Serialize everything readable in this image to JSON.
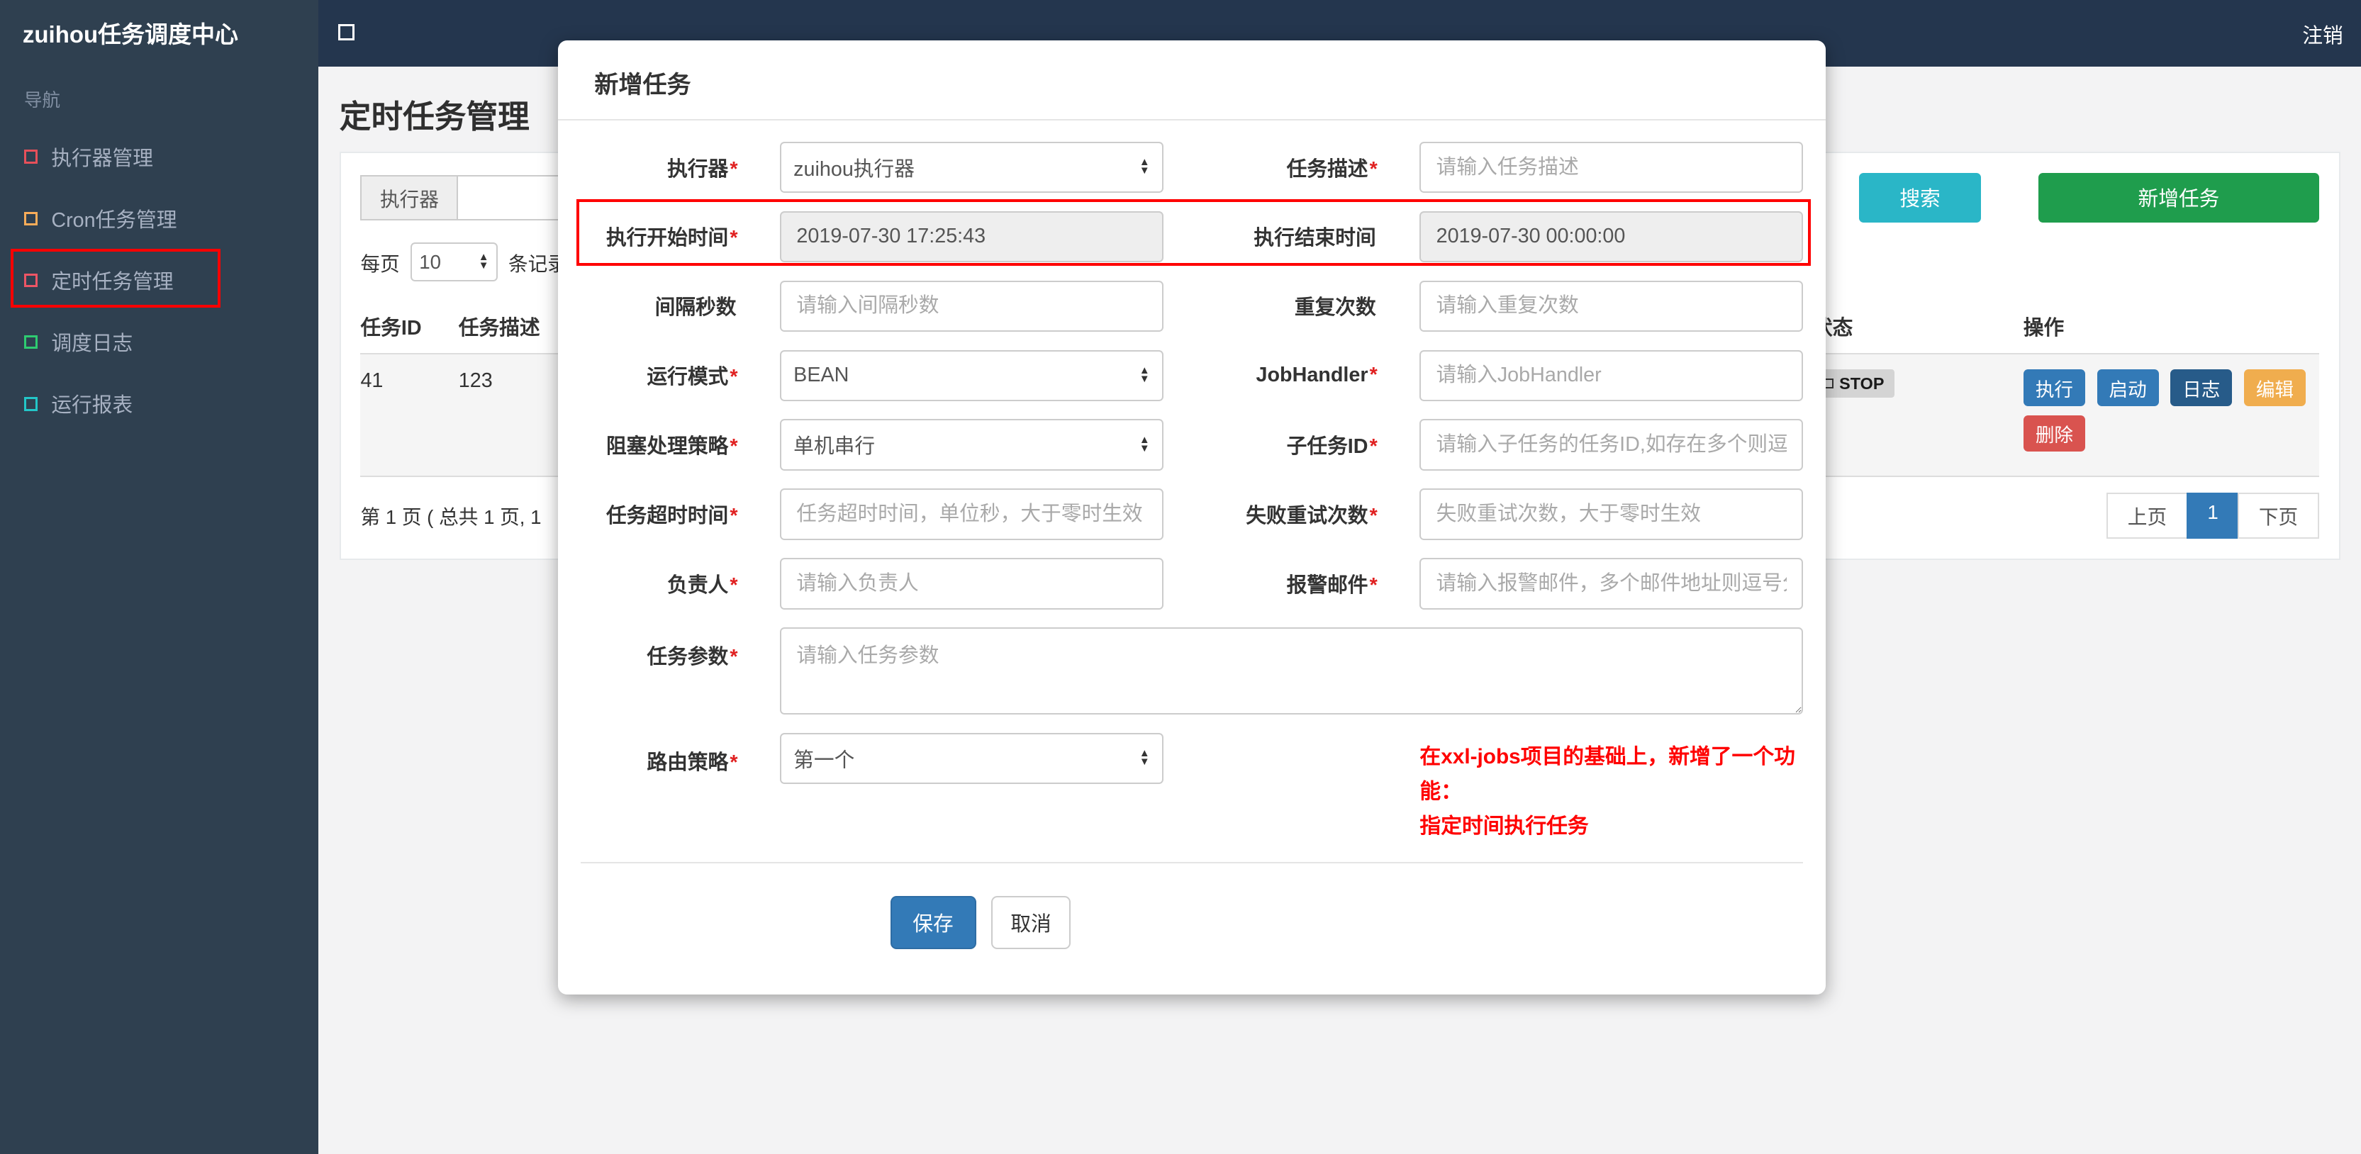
{
  "colors": {
    "annotation_red": "#ff0000",
    "search_button": "#2ab6c7",
    "add_button": "#1f9d4d",
    "save_button": "#337ab7",
    "status_stop_badge": "#d4d4d4",
    "note_red": "#ff0000"
  },
  "header": {
    "brand": "zuihou任务调度中心",
    "logout": "注销"
  },
  "sidebar": {
    "section_label": "导航",
    "items": [
      {
        "label": "执行器管理",
        "icon_color": "#e7505a"
      },
      {
        "label": "Cron任务管理",
        "icon_color": "#f8ac59"
      },
      {
        "label": "定时任务管理",
        "icon_color": "#ed5565"
      },
      {
        "label": "调度日志",
        "icon_color": "#2ecc71"
      },
      {
        "label": "运行报表",
        "icon_color": "#23c6c8"
      }
    ]
  },
  "page": {
    "title": "定时任务管理",
    "filter": {
      "executor_label": "执行器",
      "search": "搜索",
      "add_task": "新增任务"
    },
    "perpage": {
      "prefix": "每页",
      "value": "10",
      "suffix": "条记录"
    },
    "table": {
      "headers": {
        "id": "任务ID",
        "desc": "任务描述",
        "status": "状态",
        "actions": "操作"
      },
      "row": {
        "id": "41",
        "desc": "123",
        "status": "STOP",
        "btn_run": "执行",
        "btn_start": "启动",
        "btn_log": "日志",
        "btn_edit": "编辑",
        "btn_delete": "删除"
      }
    },
    "pagination": {
      "summary": "第 1 页 ( 总共 1 页, 1",
      "prev": "上页",
      "current": "1",
      "next": "下页"
    }
  },
  "modal": {
    "title": "新增任务",
    "rows": [
      {
        "l_label": "执行器",
        "l_req": "*",
        "l_value": "zuihou执行器",
        "r_label": "任务描述",
        "r_req": "*",
        "r_placeholder": "请输入任务描述"
      },
      {
        "l_label": "执行开始时间",
        "l_req": "*",
        "l_value": "2019-07-30 17:25:43",
        "r_label": "执行结束时间",
        "r_req": "",
        "r_value": "2019-07-30 00:00:00"
      },
      {
        "l_label": "间隔秒数",
        "l_req": "",
        "l_placeholder": "请输入间隔秒数",
        "r_label": "重复次数",
        "r_req": "",
        "r_placeholder": "请输入重复次数"
      },
      {
        "l_label": "运行模式",
        "l_req": "*",
        "l_value": "BEAN",
        "r_label": "JobHandler",
        "r_req": "*",
        "r_placeholder": "请输入JobHandler"
      },
      {
        "l_label": "阻塞处理策略",
        "l_req": "*",
        "l_value": "单机串行",
        "r_label": "子任务ID",
        "r_req": "*",
        "r_placeholder": "请输入子任务的任务ID,如存在多个则逗"
      },
      {
        "l_label": "任务超时时间",
        "l_req": "*",
        "l_placeholder": "任务超时时间，单位秒，大于零时生效",
        "r_label": "失败重试次数",
        "r_req": "*",
        "r_placeholder": "失败重试次数，大于零时生效"
      },
      {
        "l_label": "负责人",
        "l_req": "*",
        "l_placeholder": "请输入负责人",
        "r_label": "报警邮件",
        "r_req": "*",
        "r_placeholder": "请输入报警邮件，多个邮件地址则逗号分"
      }
    ],
    "params": {
      "label": "任务参数",
      "req": "*",
      "placeholder": "请输入任务参数"
    },
    "route": {
      "label": "路由策略",
      "req": "*",
      "value": "第一个"
    },
    "note_line1": "在xxl-jobs项目的基础上，新增了一个功能：",
    "note_line2": "指定时间执行任务",
    "save": "保存",
    "cancel": "取消"
  }
}
